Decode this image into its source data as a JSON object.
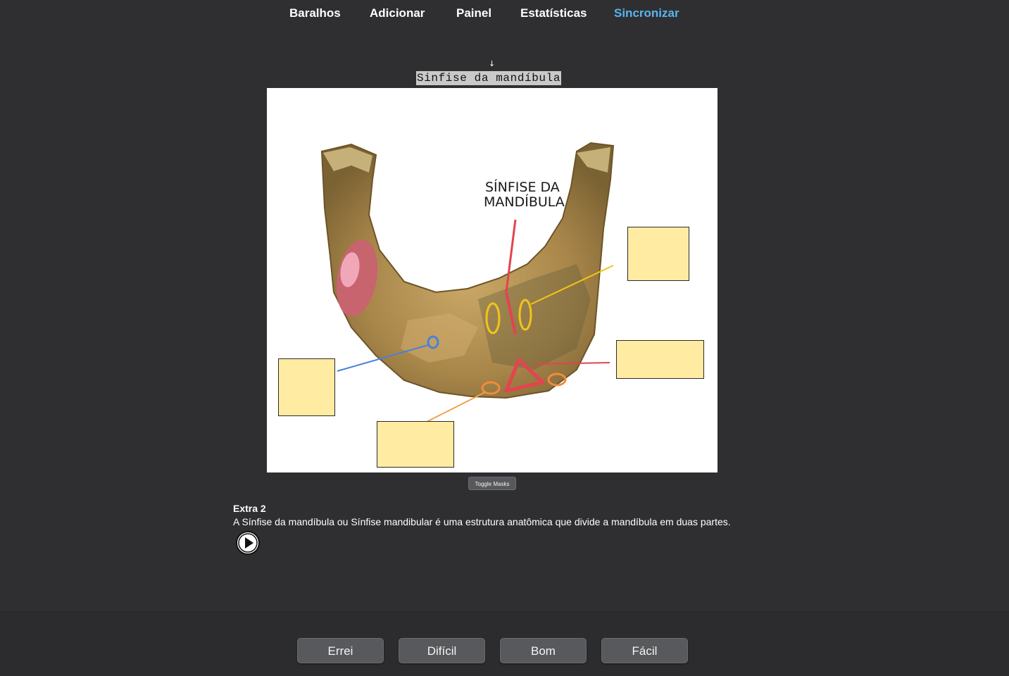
{
  "nav": {
    "items": [
      "Baralhos",
      "Adicionar",
      "Painel",
      "Estatísticas"
    ],
    "sync": "Sincronizar",
    "sync_color": "#5ab4f0"
  },
  "card": {
    "arrow": "↓",
    "title": "Sinfise da mandíbula",
    "image_caption": [
      "SÍNFISE DA",
      "MANDÍBULA"
    ],
    "mask_color": "#ffeba2",
    "masks_count": 5
  },
  "toggle_masks": "Toggle Masks",
  "extra": {
    "title": "Extra 2",
    "text": "A Sínfise da mandíbula ou Sínfise mandibular é uma estrutura anatômica que divide a mandíbula em duas partes."
  },
  "play_icon": "play-circle-icon",
  "answer_buttons": [
    "Errei",
    "Difícil",
    "Bom",
    "Fácil"
  ]
}
